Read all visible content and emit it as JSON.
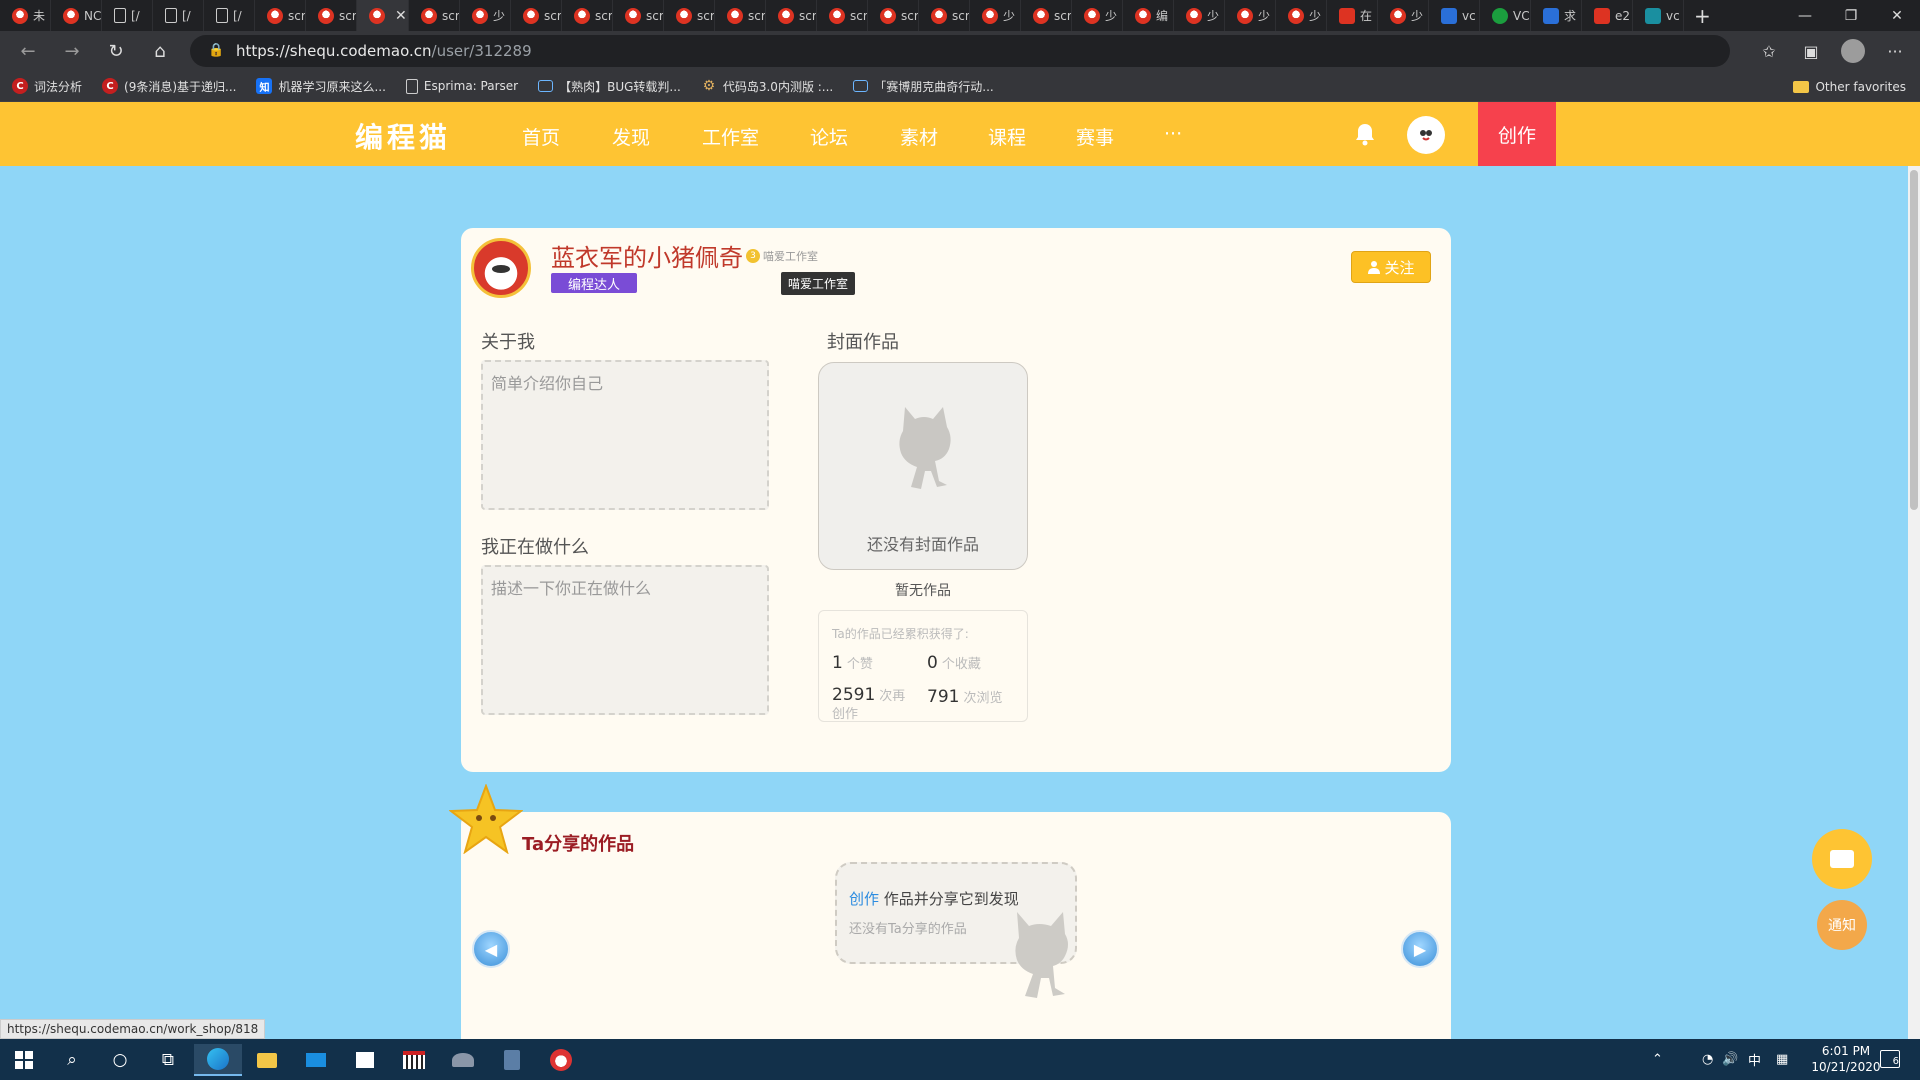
{
  "browser": {
    "tabs": [
      {
        "icon": "codemao-icon",
        "label": "未"
      },
      {
        "icon": "codemao-icon",
        "label": "NC"
      },
      {
        "icon": "page-icon",
        "label": "[/"
      },
      {
        "icon": "page-icon",
        "label": "[/"
      },
      {
        "icon": "page-icon",
        "label": "[/"
      },
      {
        "icon": "codemao-icon",
        "label": "scr"
      },
      {
        "icon": "codemao-icon",
        "label": "scr"
      },
      {
        "icon": "codemao-icon",
        "label": ""
      },
      {
        "icon": "codemao-icon",
        "label": "scr"
      },
      {
        "icon": "codemao-icon",
        "label": "少"
      },
      {
        "icon": "codemao-icon",
        "label": "scr"
      },
      {
        "icon": "codemao-icon",
        "label": "scr"
      },
      {
        "icon": "codemao-icon",
        "label": "scr"
      },
      {
        "icon": "codemao-icon",
        "label": "scr"
      },
      {
        "icon": "codemao-icon",
        "label": "scr"
      },
      {
        "icon": "codemao-icon",
        "label": "scr"
      },
      {
        "icon": "codemao-icon",
        "label": "scr"
      },
      {
        "icon": "codemao-icon",
        "label": "scr"
      },
      {
        "icon": "codemao-icon",
        "label": "scr"
      },
      {
        "icon": "codemao-icon",
        "label": "少"
      },
      {
        "icon": "codemao-icon",
        "label": "scr"
      },
      {
        "icon": "codemao-icon",
        "label": "少"
      },
      {
        "icon": "codemao-icon",
        "label": "编"
      },
      {
        "icon": "codemao-icon",
        "label": "少"
      },
      {
        "icon": "codemao-icon",
        "label": "少"
      },
      {
        "icon": "codemao-icon",
        "label": "少"
      },
      {
        "icon": "red-icon",
        "label": "在"
      },
      {
        "icon": "codemao-icon",
        "label": "少"
      },
      {
        "icon": "bing-icon",
        "label": "vc"
      },
      {
        "icon": "green-icon",
        "label": "VC"
      },
      {
        "icon": "zhihu-icon",
        "label": "求"
      },
      {
        "icon": "red-icon",
        "label": "e2"
      },
      {
        "icon": "teal-icon",
        "label": "vc"
      }
    ],
    "active_tab": 7,
    "url_host": "https://shequ.codemao.cn",
    "url_path": "/user/312289",
    "bookmarks": [
      {
        "icon": "c",
        "label": "词法分析"
      },
      {
        "icon": "c",
        "label": "(9条消息)基于递归..."
      },
      {
        "icon": "zhi",
        "label": "机器学习原来这么..."
      },
      {
        "icon": "doc",
        "label": "Esprima: Parser"
      },
      {
        "icon": "tv",
        "label": "【熟肉】BUG转载判..."
      },
      {
        "icon": "gear",
        "label": "代码岛3.0内测版 :..."
      },
      {
        "icon": "tv",
        "label": "「赛博朋克曲奇行动..."
      }
    ],
    "other_favorites": "Other favorites",
    "status_url": "https://shequ.codemao.cn/work_shop/818"
  },
  "site": {
    "logo": "编程猫",
    "nav": [
      "首页",
      "发现",
      "工作室",
      "论坛",
      "素材",
      "课程",
      "赛事",
      "···"
    ],
    "create_label": "创作"
  },
  "profile": {
    "name": "蓝衣军的小猪佩奇",
    "studio_level": "3",
    "studio_tag": "喵爱工作室",
    "badge": "编程达人",
    "tooltip": "喵爱工作室",
    "follow_label": "关注",
    "about_title": "关于我",
    "about_placeholder": "简单介绍你自己",
    "doing_title": "我正在做什么",
    "doing_placeholder": "描述一下你正在做什么",
    "cover_title": "封面作品",
    "cover_empty": "还没有封面作品",
    "no_works": "暂无作品",
    "stats_title": "Ta的作品已经累积获得了:",
    "stats": {
      "likes": "1",
      "likes_unit": "个赞",
      "favorites": "0",
      "favorites_unit": "个收藏",
      "recreations": "2591",
      "recreations_unit": "次再创作",
      "views": "791",
      "views_unit": "次浏览"
    }
  },
  "shared": {
    "title": "Ta分享的作品",
    "create_link": "创作",
    "create_text": " 作品并分享它到发现",
    "empty_text": "还没有Ta分享的作品"
  },
  "floating": {
    "notify_label": "通知"
  },
  "taskbar": {
    "time": "6:01 PM",
    "date": "10/21/2020",
    "ime": "中",
    "notification_count": "6"
  }
}
